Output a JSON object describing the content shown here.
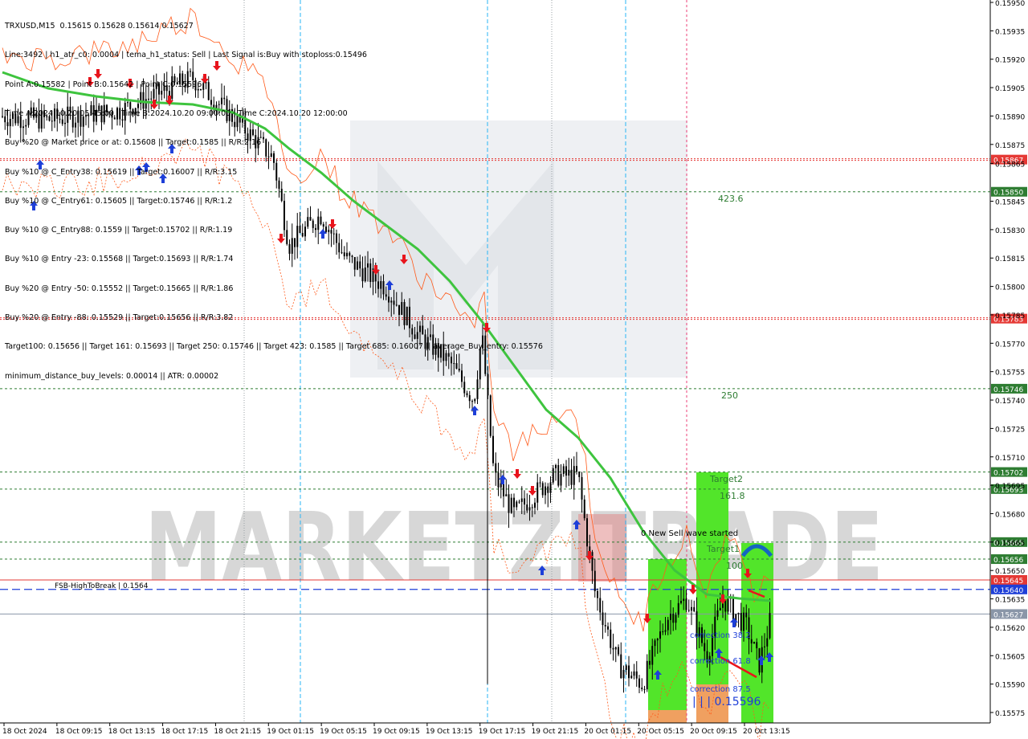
{
  "header": {
    "lines": [
      "TRXUSD,M15  0.15615 0.15628 0.15614 0.15627",
      "Line:3492 | h1_atr_c0: 0.0004 | tema_h1_status: Sell | Last Signal is:Buy with stoploss:0.15496",
      "Point A:0.15582 | Point B:0.15642 | Point C:0.15596",
      "Time A:2024.10.20 05:45:00 | Time B:2024.10.20 09:00:00 | Time C:2024.10.20 12:00:00",
      "Buy %20 @ Market price or at: 0.15608 || Target:0.1585 || R/R:2.16",
      "Buy %10 @ C_Entry38: 0.15619 || Target:0.16007 || R/R:3.15",
      "Buy %10 @ C_Entry61: 0.15605 || Target:0.15746 || R/R:1.2",
      "Buy %10 @ C_Entry88: 0.1559 || Target:0.15702 || R/R:1.19",
      "Buy %10 @ Entry -23: 0.15568 || Target:0.15693 || R/R:1.74",
      "Buy %20 @ Entry -50: 0.15552 || Target:0.15665 || R/R:1.86",
      "Buy %20 @ Entry -88: 0.15529 || Target:0.15656 || R/R:3.82",
      "Target100: 0.15656 || Target 161: 0.15693 || Target 250: 0.15746 || Target 423: 0.1585 || Target 685: 0.16007 || average_Buy_entry: 0.15576",
      "minimum_distance_buy_levels: 0.00014 || ATR: 0.00002"
    ]
  },
  "chart_data": {
    "type": "candlestick",
    "symbol": "TRXUSD",
    "timeframe": "M15",
    "ylim": [
      0.1557,
      0.15952
    ],
    "y_ticks": [
      "0.15950",
      "0.15935",
      "0.15920",
      "0.15905",
      "0.15890",
      "0.15875",
      "0.15865",
      "0.15845",
      "0.15830",
      "0.15815",
      "0.15800",
      "0.15785",
      "0.15770",
      "0.15755",
      "0.15740",
      "0.15725",
      "0.15710",
      "0.15695",
      "0.15680",
      "0.15665",
      "0.15650",
      "0.15635",
      "0.15620",
      "0.15605",
      "0.15590",
      "0.15575"
    ],
    "x_ticks": [
      "18 Oct 2024",
      "18 Oct 09:15",
      "18 Oct 13:15",
      "18 Oct 17:15",
      "18 Oct 21:15",
      "19 Oct 01:15",
      "19 Oct 05:15",
      "19 Oct 09:15",
      "19 Oct 13:15",
      "19 Oct 17:15",
      "19 Oct 21:15",
      "20 Oct 01:15",
      "20 Oct 05:15",
      "20 Oct 09:15",
      "20 Oct 13:15"
    ],
    "levels": [
      {
        "price": 0.15867,
        "label": "0.15867",
        "color": "#e53935",
        "style": "dotted-double"
      },
      {
        "price": 0.1585,
        "label": "0.15850",
        "color": "#2e7d32",
        "style": "dashed"
      },
      {
        "price": 0.15783,
        "label": "0.15783",
        "color": "#e53935",
        "style": "dotted-double"
      },
      {
        "price": 0.15746,
        "label": "0.15746",
        "color": "#2e7d32",
        "style": "dashed"
      },
      {
        "price": 0.15702,
        "label": "0.15702",
        "color": "#2e7d32",
        "style": "dashed"
      },
      {
        "price": 0.15693,
        "label": "0.15693",
        "color": "#2e7d32",
        "style": "dashed"
      },
      {
        "price": 0.15665,
        "label": "0.15665",
        "color": "#2e7d32",
        "style": "dashed"
      },
      {
        "price": 0.15656,
        "label": "0.15656",
        "color": "#2e7d32",
        "style": "dashed"
      },
      {
        "price": 0.15645,
        "label": "0.15645",
        "color": "#e53935",
        "style": "solid"
      },
      {
        "price": 0.1564,
        "label": "0.15640",
        "color": "#1e3fd8",
        "style": "long-dash"
      },
      {
        "price": 0.15627,
        "label": "0.15627",
        "color": "#8a96a8",
        "style": "solid"
      }
    ],
    "annotations": [
      {
        "text": "423.6",
        "color": "#2e7d32"
      },
      {
        "text": "250",
        "color": "#2e7d32"
      },
      {
        "text": "Target2",
        "color": "#2e7d32"
      },
      {
        "text": "161.8",
        "color": "#2e7d32"
      },
      {
        "text": "0 New Sell wave started",
        "color": "#000000"
      },
      {
        "text": "Target1",
        "color": "#2e7d32"
      },
      {
        "text": "100",
        "color": "#2e7d32"
      },
      {
        "text": "FSB-HighToBreak | 0.1564",
        "color": "#000000"
      },
      {
        "text": "correction 38.2",
        "color": "#1e3fd8"
      },
      {
        "text": "correction 61.8",
        "color": "#1e3fd8"
      },
      {
        "text": "correction 87.5",
        "color": "#1e3fd8"
      },
      {
        "text": "| | | 0.15596",
        "color": "#1e3fd8"
      }
    ],
    "watermark": "MARKETZITRADE",
    "colors": {
      "candle": "#000000",
      "ma": "#3ec43e",
      "envelope": "#ff5a1a",
      "buy_arrow": "#1e3fd8",
      "sell_arrow": "#e8141c",
      "zone_green": "#52e52a",
      "zone_orange": "#f0a060"
    }
  }
}
